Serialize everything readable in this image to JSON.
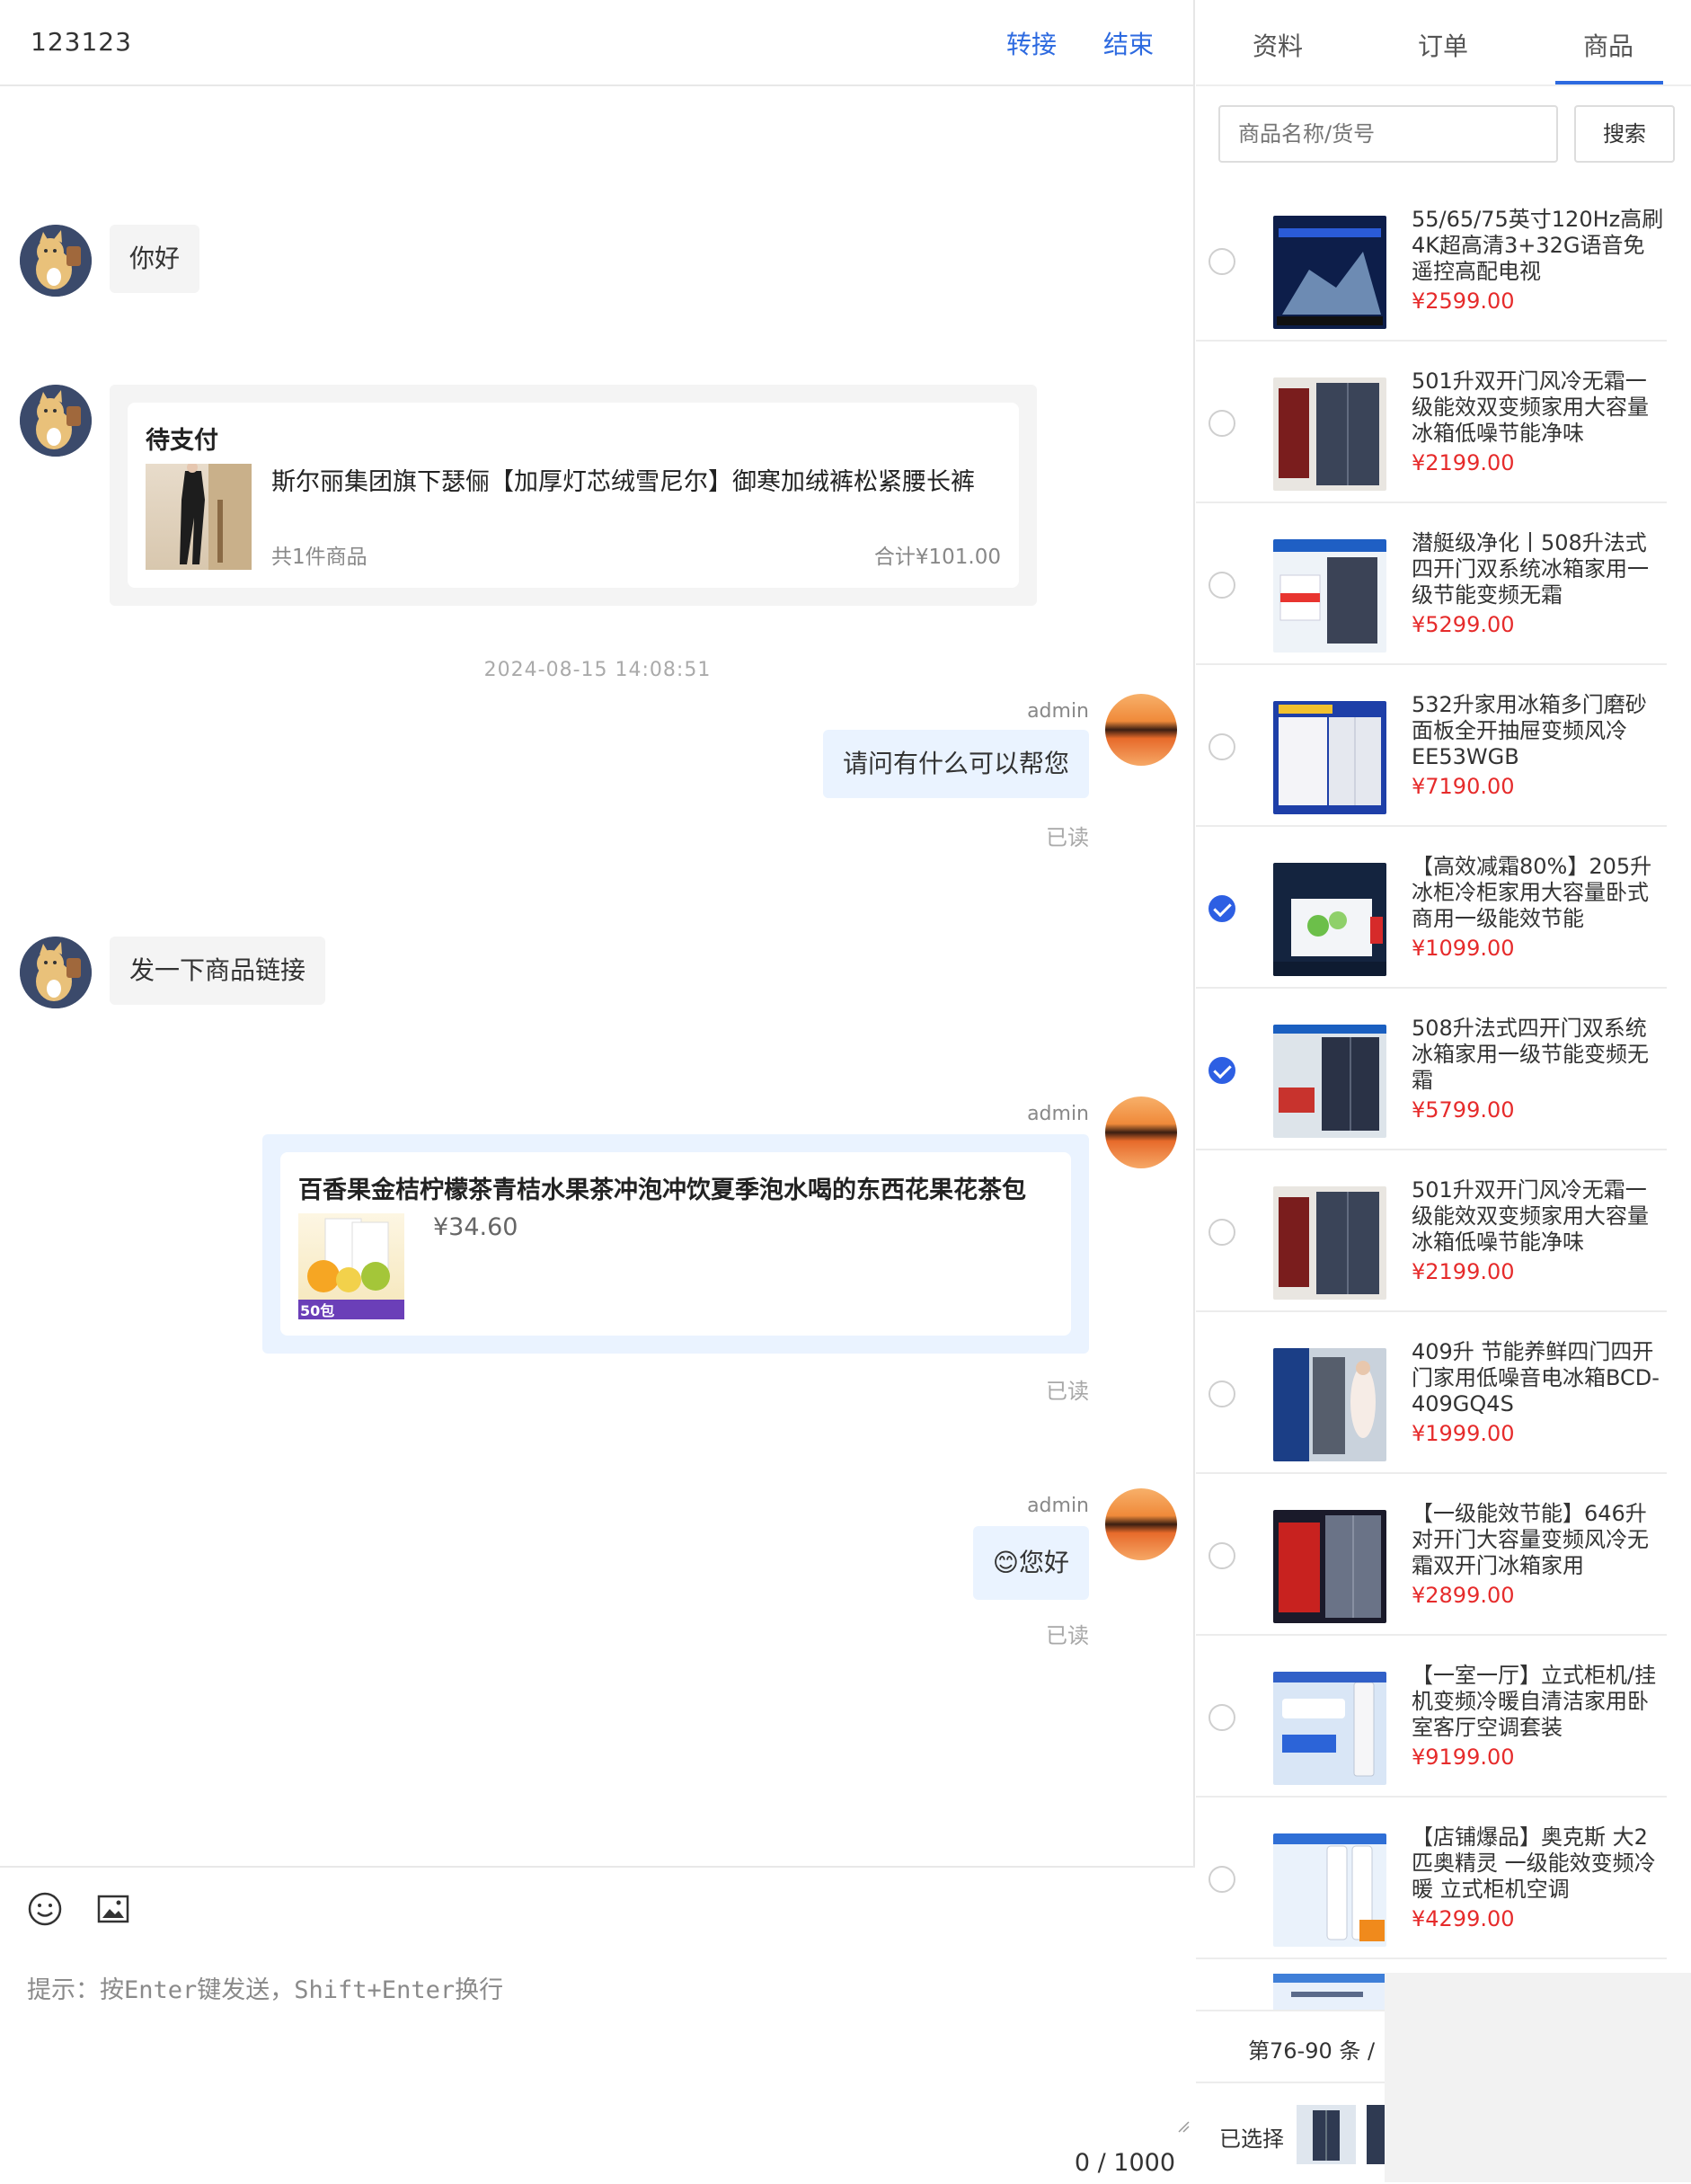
{
  "chat": {
    "title": "123123",
    "transfer_label": "转接",
    "end_label": "结束",
    "messages": {
      "m1": "你好",
      "order_status": "待支付",
      "order_title": "斯尔丽集团旗下瑟俪【加厚灯芯绒雪尼尔】御寒加绒裤松紧腰长裤",
      "order_count": "共1件商品",
      "order_total": "合计¥101.00",
      "timestamp": "2024-08-15 14:08:51",
      "admin": "admin",
      "m2": "请问有什么可以帮您",
      "read": "已读",
      "m3": "发一下商品链接",
      "link_title": "百香果金桔柠檬茶青桔水果茶冲泡冲饮夏季泡水喝的东西花果花茶包",
      "link_price": "¥34.60",
      "link_badge": "50包",
      "m4": "您好",
      "emoji": "😊"
    },
    "composer": {
      "hint": "提示：按Enter键发送，Shift+Enter换行",
      "counter": "0 / 1000",
      "emoji_icon": "smile-icon",
      "image_icon": "image-icon"
    }
  },
  "panel": {
    "tabs": [
      "资料",
      "订单",
      "商品"
    ],
    "active_tab": "商品",
    "search_placeholder": "商品名称/货号",
    "search_button": "搜索",
    "products": [
      {
        "title": "55/65/75英寸120Hz高刷4K超高清3+32G语音免遥控高配电视",
        "price": "¥2599.00",
        "checked": false
      },
      {
        "title": "501升双开门风冷无霜一级能效双变频家用大容量冰箱低噪节能净味",
        "price": "¥2199.00",
        "checked": false
      },
      {
        "title": "潜艇级净化丨508升法式四开门双系统冰箱家用一级节能变频无霜",
        "price": "¥5299.00",
        "checked": false
      },
      {
        "title": "532升家用冰箱多门磨砂面板全开抽屉变频风冷EE53WGB",
        "price": "¥7190.00",
        "checked": false
      },
      {
        "title": "【高效减霜80%】205升冰柜冷柜家用大容量卧式商用一级能效节能",
        "price": "¥1099.00",
        "checked": true
      },
      {
        "title": "508升法式四开门双系统冰箱家用一级节能变频无霜",
        "price": "¥5799.00",
        "checked": true
      },
      {
        "title": "501升双开门风冷无霜一级能效双变频家用大容量冰箱低噪节能净味",
        "price": "¥2199.00",
        "checked": false
      },
      {
        "title": "409升 节能养鲜四门四开门家用低噪音电冰箱BCD-409GQ4S",
        "price": "¥1999.00",
        "checked": false
      },
      {
        "title": "【一级能效节能】646升对开门大容量变频风冷无霜双开门冰箱家用",
        "price": "¥2899.00",
        "checked": false
      },
      {
        "title": "【一室一厅】立式柜机/挂机变频冷暖自清洁家用卧室客厅空调套装",
        "price": "¥9199.00",
        "checked": false
      },
      {
        "title": "【店铺爆品】奥克斯 大2匹奥精灵 一级能效变频冷暖 立式柜机空调",
        "price": "¥4299.00",
        "checked": false
      }
    ],
    "pagination": "第76-90 条 /",
    "selected_label": "已选择"
  },
  "colors": {
    "accent": "#2d6ae0",
    "price": "#e62b2b",
    "bubble_self": "#eaf3ff",
    "bubble_other": "#f4f4f4"
  }
}
